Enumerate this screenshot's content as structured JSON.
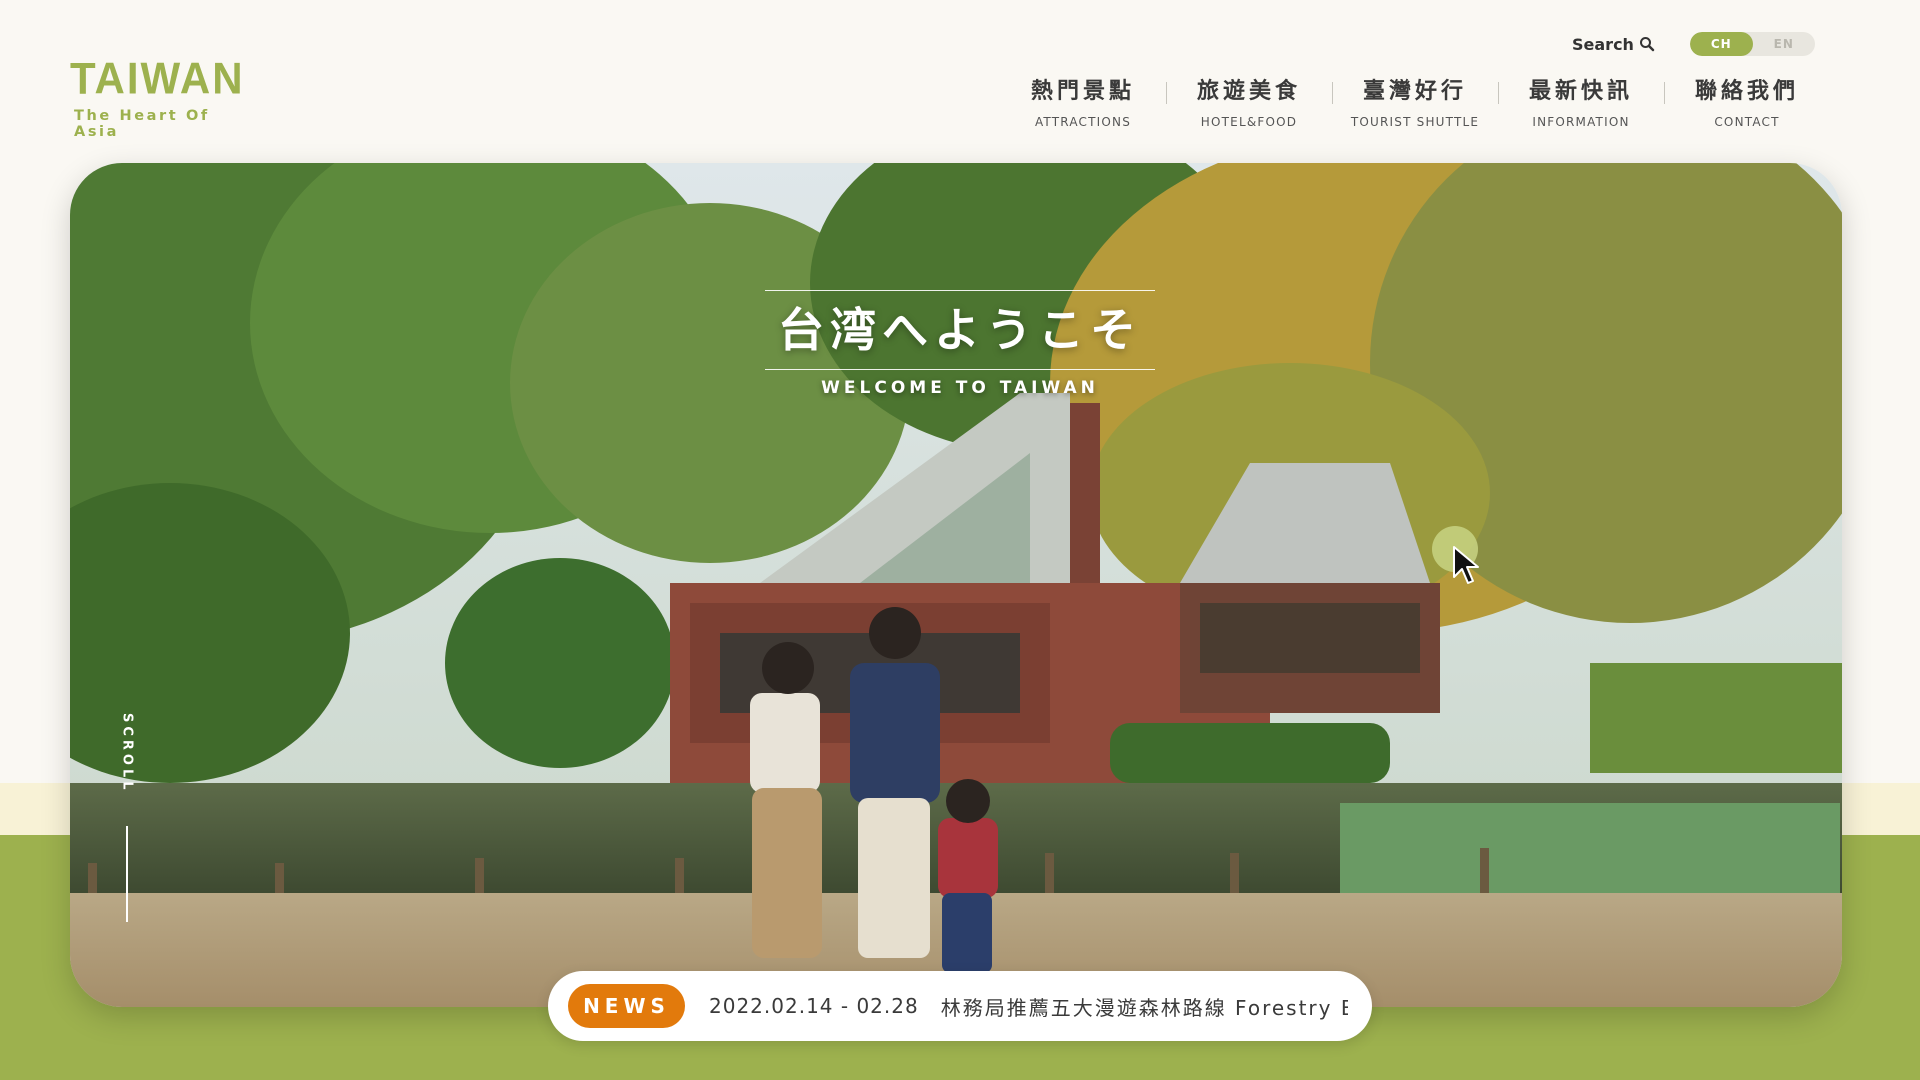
{
  "brand": {
    "title": "TAIWAN",
    "subtitle": "The Heart Of Asia",
    "accent_color": "#9db14e"
  },
  "header": {
    "search_label": "Search",
    "search_icon": "search-icon",
    "languages": [
      {
        "label": "CH",
        "active": true
      },
      {
        "label": "EN",
        "active": false
      }
    ]
  },
  "nav": [
    {
      "zh": "熱門景點",
      "en": "ATTRACTIONS"
    },
    {
      "zh": "旅遊美食",
      "en": "HOTEL&FOOD"
    },
    {
      "zh": "臺灣好行",
      "en": "TOURIST SHUTTLE"
    },
    {
      "zh": "最新快訊",
      "en": "INFORMATION"
    },
    {
      "zh": "聯絡我們",
      "en": "CONTACT"
    }
  ],
  "hero": {
    "title_jp": "台湾へようこそ",
    "title_en": "WELCOME TO TAIWAN",
    "scroll_label": "SCROLL"
  },
  "news": {
    "badge": "NEWS",
    "date": "2022.02.14 - 02.28",
    "text": "林務局推薦五大漫遊森林路線 Forestry Bur",
    "badge_color": "#e27a0c"
  }
}
